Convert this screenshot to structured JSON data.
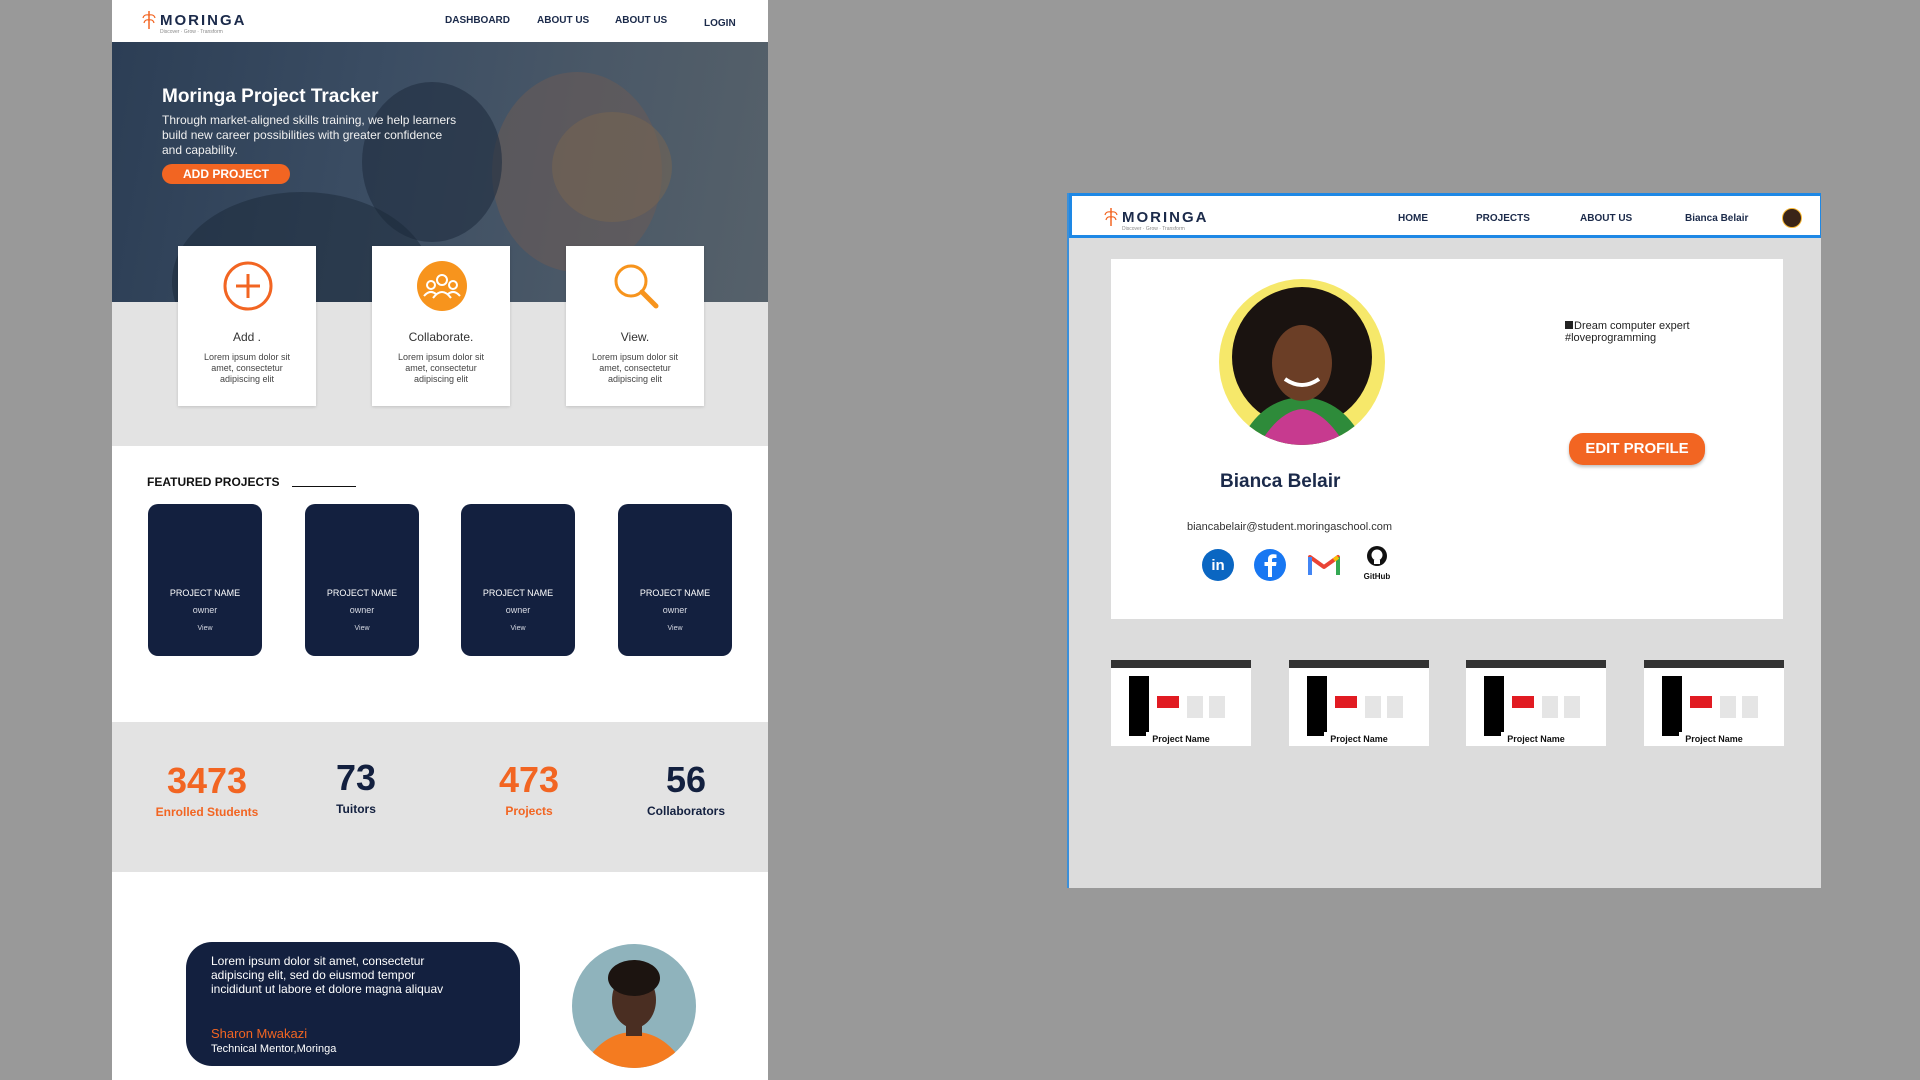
{
  "landing": {
    "logo": {
      "word": "MORINGA",
      "tagline": "Discover · Grow · Transform"
    },
    "nav": {
      "dashboard": "DASHBOARD",
      "about1": "ABOUT US",
      "about2": "ABOUT US",
      "login": "LOGIN"
    },
    "hero": {
      "title": "Moringa Project Tracker",
      "text": "Through market-aligned skills training, we help learners build new career possibilities with greater confidence and capability.",
      "button": "ADD PROJECT"
    },
    "features": [
      {
        "icon": "add-circle-icon",
        "title": "Add .",
        "desc": "Lorem ipsum dolor sit amet, consectetur adipiscing elit"
      },
      {
        "icon": "people-group-icon",
        "title": "Collaborate.",
        "desc": "Lorem ipsum dolor sit amet, consectetur adipiscing elit"
      },
      {
        "icon": "magnifier-icon",
        "title": "View.",
        "desc": "Lorem ipsum dolor sit amet, consectetur adipiscing elit"
      }
    ],
    "featured_heading": "FEATURED PROJECTS",
    "projects": [
      {
        "name": "PROJECT NAME",
        "owner": "owner",
        "view": "View"
      },
      {
        "name": "PROJECT NAME",
        "owner": "owner",
        "view": "View"
      },
      {
        "name": "PROJECT NAME",
        "owner": "owner",
        "view": "View"
      },
      {
        "name": "PROJECT NAME",
        "owner": "owner",
        "view": "View"
      }
    ],
    "stats": [
      {
        "value": "3473",
        "label": "Enrolled  Students"
      },
      {
        "value": "73",
        "label": "Tuitors"
      },
      {
        "value": "473",
        "label": "Projects"
      },
      {
        "value": "56",
        "label": "Collaborators"
      }
    ],
    "testimonial": {
      "quote": "Lorem ipsum dolor sit amet, consectetur adipiscing elit, sed do eiusmod tempor incididunt ut labore et dolore magna aliquav",
      "name": "Sharon Mwakazi",
      "role": "Technical Mentor,Moringa"
    }
  },
  "profile": {
    "logo": {
      "word": "MORINGA",
      "tagline": "Discover · Grow · Transform"
    },
    "nav": {
      "home": "HOME",
      "projects": "PROJECTS",
      "about": "ABOUT US",
      "user": "Bianca Belair"
    },
    "name": "Bianca Belair",
    "email": "biancabelair@student.moringaschool.com",
    "bio_line1": "Dream computer expert",
    "bio_line2": "#loveprogramming",
    "edit_button": "EDIT PROFILE",
    "social": {
      "linkedin": "in",
      "github": "GitHub"
    },
    "thumbnails": [
      {
        "label": "Project Name"
      },
      {
        "label": "Project Name"
      },
      {
        "label": "Project Name"
      },
      {
        "label": "Project Name"
      }
    ]
  },
  "colors": {
    "brand_orange": "#f26522",
    "navy": "#13203f",
    "gray_bg": "#999999",
    "accent_blue": "#1e88e5"
  }
}
